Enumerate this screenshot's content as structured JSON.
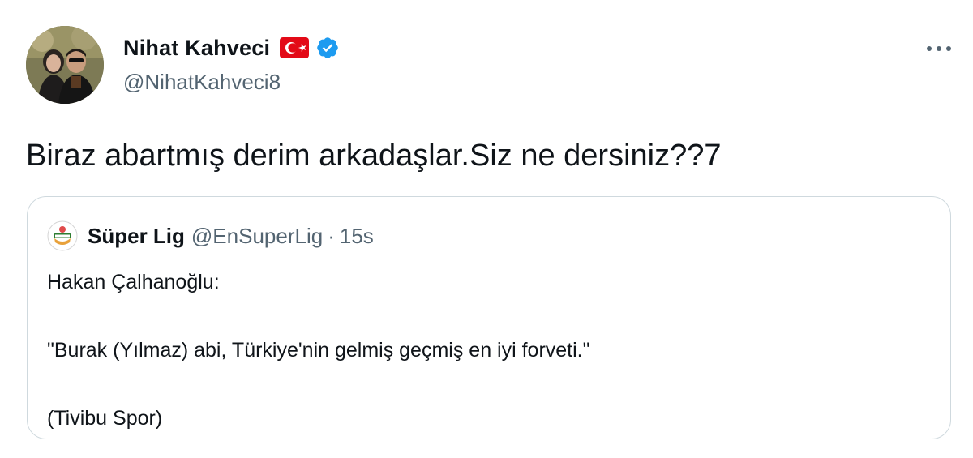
{
  "author": {
    "name": "Nihat Kahveci",
    "handle": "@NihatKahveci8",
    "flag_icon": "turkey-flag-icon",
    "verified_icon": "verified-badge-icon"
  },
  "menu": {
    "icon": "more-options-icon"
  },
  "tweet": {
    "text": "Biraz abartmış derim arkadaşlar.Siz ne dersiniz??7"
  },
  "quoted": {
    "name": "Süper Lig",
    "handle": "@EnSuperLig",
    "separator": "·",
    "time": "15s",
    "lines": [
      "Hakan Çalhanoğlu:",
      "",
      "\"Burak (Yılmaz) abi, Türkiye'nin gelmiş geçmiş en iyi forveti.\"",
      "",
      "(Tivibu Spor)"
    ]
  },
  "colors": {
    "text": "#0f1419",
    "secondary": "#536471",
    "border": "#cfd9de",
    "verified": "#1d9bf0",
    "flag_red": "#e30a17"
  }
}
